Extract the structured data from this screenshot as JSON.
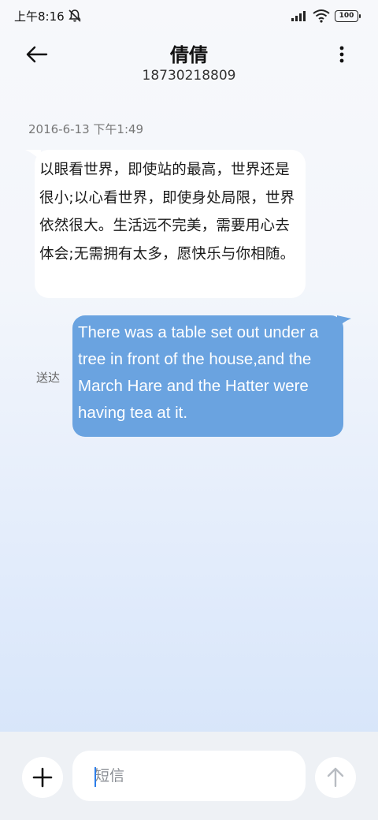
{
  "status_bar": {
    "time": "上午8:16",
    "battery": "100",
    "icons": [
      "mute-icon",
      "signal-icon",
      "wifi-icon",
      "battery-icon"
    ]
  },
  "header": {
    "contact_name": "倩倩",
    "contact_number": "18730218809",
    "back_icon": "arrow-left-icon",
    "more_icon": "more-vertical-icon"
  },
  "conversation": {
    "timestamp": "2016-6-13 下午1:49",
    "received": {
      "text": "以眼看世界，即使站的最高，世界还是很小;以心看世界，即使身处局限，世界依然很大。生活远不完美，需要用心去体会;无需拥有太多，愿快乐与你相随。"
    },
    "sent": {
      "status": "送达",
      "text": "There was a table set out under a tree in front of the house,and the March Hare and the Hatter were having tea at it."
    }
  },
  "composer": {
    "placeholder": "短信",
    "attach_icon": "plus-icon",
    "send_icon": "arrow-up-icon"
  },
  "colors": {
    "sent_bubble": "#6aa3e0",
    "received_bubble": "#ffffff",
    "caret": "#2b7de9"
  }
}
